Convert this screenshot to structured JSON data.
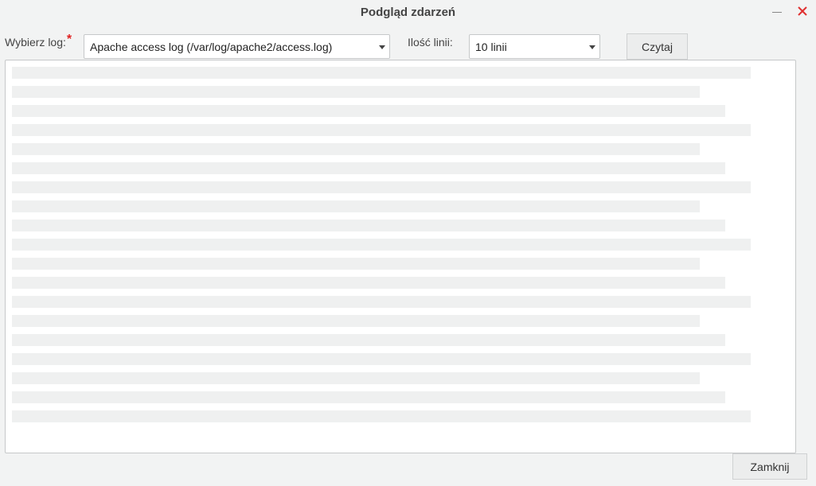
{
  "window": {
    "title": "Podgląd zdarzeń",
    "minimize_icon": "minimize-icon",
    "close_icon": "close-icon",
    "close_color": "#e03030"
  },
  "controls": {
    "log_label": "Wybierz log:",
    "required_mark": "*",
    "log_selected": "Apache access log (/var/log/apache2/access.log)",
    "lines_label": "Ilość linii:",
    "lines_selected": "10 linii",
    "read_button": "Czytaj"
  },
  "footer": {
    "close_button": "Zamknij"
  }
}
